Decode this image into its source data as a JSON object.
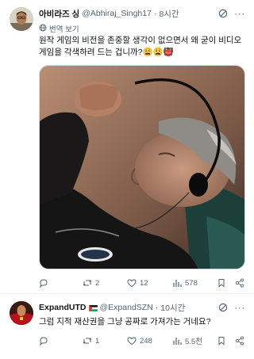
{
  "tweets": [
    {
      "display_name": "아비라즈 싱",
      "handle": "@Abhiraj_Singh17",
      "time_sep": "·",
      "time": "8시간",
      "translate_label": "번역 보기",
      "text_line1": "원작 게임의 비전을 존중할 생각이 없으면서 왜 굳이 비디오",
      "text_line2": "게임을 각색하려 드는 겁니까?😩😩👹",
      "replies": "",
      "retweets": "2",
      "likes": "12",
      "views": "578"
    },
    {
      "display_name": "ExpandUTD",
      "handle": "@ExpandSZN",
      "time_sep": "·",
      "time": "10시간",
      "text_line1": "그럼 지적 재산권을 그냥 공짜로 가져가는 거네요?",
      "replies": "",
      "retweets": "1",
      "likes": "248",
      "views": "5.5천"
    }
  ],
  "icons": {
    "grok": "grok-icon",
    "more": "more-icon",
    "reply": "reply-icon",
    "retweet": "retweet-icon",
    "like": "heart-icon",
    "views": "views-icon",
    "bookmark": "bookmark-icon",
    "share": "share-icon",
    "globe": "globe-icon"
  },
  "colors": {
    "text": "#0f1419",
    "secondary": "#536471",
    "border": "#eff3f4"
  }
}
